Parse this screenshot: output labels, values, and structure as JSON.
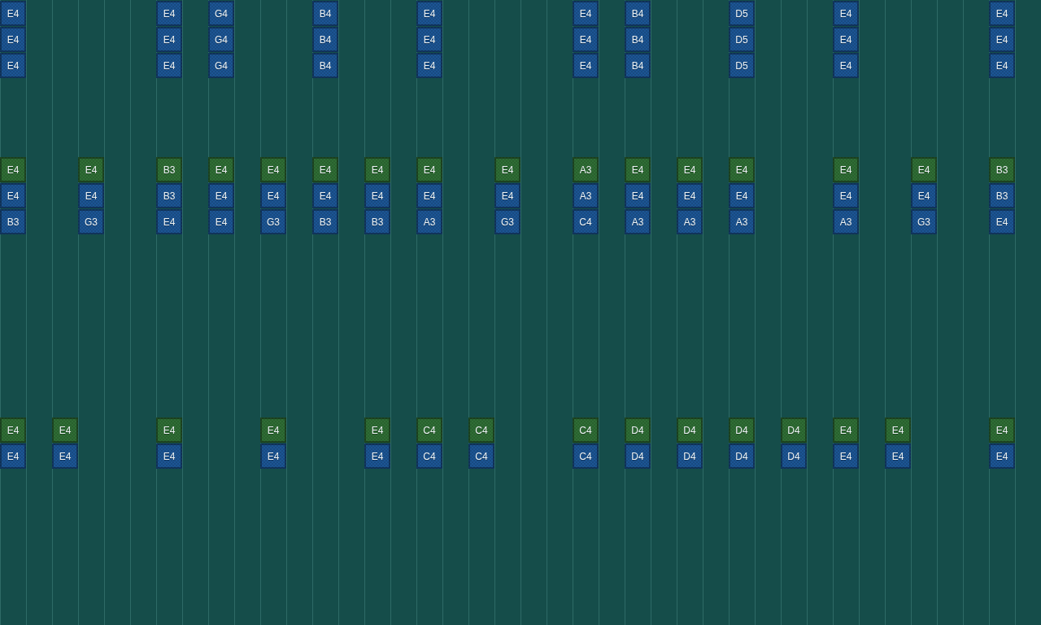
{
  "lanes": [
    {
      "cells": [
        {
          "note": "E4",
          "color": "#1c5594"
        },
        {
          "note": "E4",
          "color": "#1c5594"
        },
        {
          "note": "E4",
          "color": "#1c5594"
        },
        null,
        null,
        null,
        {
          "note": "E4",
          "color": "#2f6e35"
        },
        {
          "note": "E4",
          "color": "#1c5594"
        },
        {
          "note": "B3",
          "color": "#1c5594"
        },
        null,
        null,
        null,
        null,
        null,
        null,
        null,
        {
          "note": "E4",
          "color": "#2f6e35"
        },
        {
          "note": "E4",
          "color": "#1c5594"
        }
      ]
    },
    {
      "cells": [
        null,
        null,
        null,
        null,
        null,
        null,
        null,
        null,
        null,
        null,
        null,
        null,
        null,
        null,
        null,
        null,
        null,
        null
      ]
    },
    {
      "cells": [
        null,
        null,
        null,
        null,
        null,
        null,
        null,
        null,
        null,
        null,
        null,
        null,
        null,
        null,
        null,
        null,
        {
          "note": "E4",
          "color": "#2f6e35"
        },
        {
          "note": "E4",
          "color": "#1c5594"
        }
      ]
    },
    {
      "cells": [
        null,
        null,
        null,
        null,
        null,
        null,
        {
          "note": "E4",
          "color": "#2f6e35"
        },
        {
          "note": "E4",
          "color": "#1c5594"
        },
        {
          "note": "G3",
          "color": "#1c5594"
        },
        null,
        null,
        null,
        null,
        null,
        null,
        null,
        null,
        null
      ]
    },
    {
      "cells": [
        null,
        null,
        null,
        null,
        null,
        null,
        null,
        null,
        null,
        null,
        null,
        null,
        null,
        null,
        null,
        null,
        null,
        null
      ]
    },
    {
      "cells": [
        null,
        null,
        null,
        null,
        null,
        null,
        null,
        null,
        null,
        null,
        null,
        null,
        null,
        null,
        null,
        null,
        null,
        null
      ]
    },
    {
      "cells": [
        {
          "note": "E4",
          "color": "#1c5594"
        },
        {
          "note": "E4",
          "color": "#1c5594"
        },
        {
          "note": "E4",
          "color": "#1c5594"
        },
        null,
        null,
        null,
        {
          "note": "B3",
          "color": "#2f6e35"
        },
        {
          "note": "B3",
          "color": "#1c5594"
        },
        {
          "note": "E4",
          "color": "#1c5594"
        },
        null,
        null,
        null,
        null,
        null,
        null,
        null,
        {
          "note": "E4",
          "color": "#2f6e35"
        },
        {
          "note": "E4",
          "color": "#1c5594"
        }
      ]
    },
    {
      "cells": [
        null,
        null,
        null,
        null,
        null,
        null,
        null,
        null,
        null,
        null,
        null,
        null,
        null,
        null,
        null,
        null,
        null,
        null
      ]
    },
    {
      "cells": [
        {
          "note": "G4",
          "color": "#1c5594"
        },
        {
          "note": "G4",
          "color": "#1c5594"
        },
        {
          "note": "G4",
          "color": "#1c5594"
        },
        null,
        null,
        null,
        {
          "note": "E4",
          "color": "#2f6e35"
        },
        {
          "note": "E4",
          "color": "#1c5594"
        },
        {
          "note": "E4",
          "color": "#1c5594"
        },
        null,
        null,
        null,
        null,
        null,
        null,
        null,
        null,
        null
      ]
    },
    {
      "cells": [
        null,
        null,
        null,
        null,
        null,
        null,
        null,
        null,
        null,
        null,
        null,
        null,
        null,
        null,
        null,
        null,
        null,
        null
      ]
    },
    {
      "cells": [
        null,
        null,
        null,
        null,
        null,
        null,
        {
          "note": "E4",
          "color": "#2f6e35"
        },
        {
          "note": "E4",
          "color": "#1c5594"
        },
        {
          "note": "G3",
          "color": "#1c5594"
        },
        null,
        null,
        null,
        null,
        null,
        null,
        null,
        {
          "note": "E4",
          "color": "#2f6e35"
        },
        {
          "note": "E4",
          "color": "#1c5594"
        }
      ]
    },
    {
      "cells": [
        null,
        null,
        null,
        null,
        null,
        null,
        null,
        null,
        null,
        null,
        null,
        null,
        null,
        null,
        null,
        null,
        null,
        null
      ]
    },
    {
      "cells": [
        {
          "note": "B4",
          "color": "#1c5594"
        },
        {
          "note": "B4",
          "color": "#1c5594"
        },
        {
          "note": "B4",
          "color": "#1c5594"
        },
        null,
        null,
        null,
        {
          "note": "E4",
          "color": "#2f6e35"
        },
        {
          "note": "E4",
          "color": "#1c5594"
        },
        {
          "note": "B3",
          "color": "#1c5594"
        },
        null,
        null,
        null,
        null,
        null,
        null,
        null,
        null,
        null
      ]
    },
    {
      "cells": [
        null,
        null,
        null,
        null,
        null,
        null,
        null,
        null,
        null,
        null,
        null,
        null,
        null,
        null,
        null,
        null,
        null,
        null
      ]
    },
    {
      "cells": [
        null,
        null,
        null,
        null,
        null,
        null,
        {
          "note": "E4",
          "color": "#2f6e35"
        },
        {
          "note": "E4",
          "color": "#1c5594"
        },
        {
          "note": "B3",
          "color": "#1c5594"
        },
        null,
        null,
        null,
        null,
        null,
        null,
        null,
        {
          "note": "E4",
          "color": "#2f6e35"
        },
        {
          "note": "E4",
          "color": "#1c5594"
        }
      ]
    },
    {
      "cells": [
        null,
        null,
        null,
        null,
        null,
        null,
        null,
        null,
        null,
        null,
        null,
        null,
        null,
        null,
        null,
        null,
        null,
        null
      ]
    },
    {
      "cells": [
        {
          "note": "E4",
          "color": "#1c5594"
        },
        {
          "note": "E4",
          "color": "#1c5594"
        },
        {
          "note": "E4",
          "color": "#1c5594"
        },
        null,
        null,
        null,
        {
          "note": "E4",
          "color": "#2f6e35"
        },
        {
          "note": "E4",
          "color": "#1c5594"
        },
        {
          "note": "A3",
          "color": "#1c5594"
        },
        null,
        null,
        null,
        null,
        null,
        null,
        null,
        {
          "note": "C4",
          "color": "#2f6e35"
        },
        {
          "note": "C4",
          "color": "#1c5594"
        }
      ]
    },
    {
      "cells": [
        null,
        null,
        null,
        null,
        null,
        null,
        null,
        null,
        null,
        null,
        null,
        null,
        null,
        null,
        null,
        null,
        null,
        null
      ]
    },
    {
      "cells": [
        null,
        null,
        null,
        null,
        null,
        null,
        null,
        null,
        null,
        null,
        null,
        null,
        null,
        null,
        null,
        null,
        {
          "note": "C4",
          "color": "#2f6e35"
        },
        {
          "note": "C4",
          "color": "#1c5594"
        }
      ]
    },
    {
      "cells": [
        null,
        null,
        null,
        null,
        null,
        null,
        {
          "note": "E4",
          "color": "#2f6e35"
        },
        {
          "note": "E4",
          "color": "#1c5594"
        },
        {
          "note": "G3",
          "color": "#1c5594"
        },
        null,
        null,
        null,
        null,
        null,
        null,
        null,
        null,
        null
      ]
    },
    {
      "cells": [
        null,
        null,
        null,
        null,
        null,
        null,
        null,
        null,
        null,
        null,
        null,
        null,
        null,
        null,
        null,
        null,
        null,
        null
      ]
    },
    {
      "cells": [
        null,
        null,
        null,
        null,
        null,
        null,
        null,
        null,
        null,
        null,
        null,
        null,
        null,
        null,
        null,
        null,
        null,
        null
      ]
    },
    {
      "cells": [
        {
          "note": "E4",
          "color": "#1c5594"
        },
        {
          "note": "E4",
          "color": "#1c5594"
        },
        {
          "note": "E4",
          "color": "#1c5594"
        },
        null,
        null,
        null,
        {
          "note": "A3",
          "color": "#2f6e35"
        },
        {
          "note": "A3",
          "color": "#1c5594"
        },
        {
          "note": "C4",
          "color": "#1c5594"
        },
        null,
        null,
        null,
        null,
        null,
        null,
        null,
        {
          "note": "C4",
          "color": "#2f6e35"
        },
        {
          "note": "C4",
          "color": "#1c5594"
        }
      ]
    },
    {
      "cells": [
        null,
        null,
        null,
        null,
        null,
        null,
        null,
        null,
        null,
        null,
        null,
        null,
        null,
        null,
        null,
        null,
        null,
        null
      ]
    },
    {
      "cells": [
        {
          "note": "B4",
          "color": "#1c5594"
        },
        {
          "note": "B4",
          "color": "#1c5594"
        },
        {
          "note": "B4",
          "color": "#1c5594"
        },
        null,
        null,
        null,
        {
          "note": "E4",
          "color": "#2f6e35"
        },
        {
          "note": "E4",
          "color": "#1c5594"
        },
        {
          "note": "A3",
          "color": "#1c5594"
        },
        null,
        null,
        null,
        null,
        null,
        null,
        null,
        {
          "note": "D4",
          "color": "#2f6e35"
        },
        {
          "note": "D4",
          "color": "#1c5594"
        }
      ]
    },
    {
      "cells": [
        null,
        null,
        null,
        null,
        null,
        null,
        null,
        null,
        null,
        null,
        null,
        null,
        null,
        null,
        null,
        null,
        null,
        null
      ]
    },
    {
      "cells": [
        null,
        null,
        null,
        null,
        null,
        null,
        {
          "note": "E4",
          "color": "#2f6e35"
        },
        {
          "note": "E4",
          "color": "#1c5594"
        },
        {
          "note": "A3",
          "color": "#1c5594"
        },
        null,
        null,
        null,
        null,
        null,
        null,
        null,
        {
          "note": "D4",
          "color": "#2f6e35"
        },
        {
          "note": "D4",
          "color": "#1c5594"
        }
      ]
    },
    {
      "cells": [
        null,
        null,
        null,
        null,
        null,
        null,
        null,
        null,
        null,
        null,
        null,
        null,
        null,
        null,
        null,
        null,
        null,
        null
      ]
    },
    {
      "cells": [
        {
          "note": "D5",
          "color": "#1c5594"
        },
        {
          "note": "D5",
          "color": "#1c5594"
        },
        {
          "note": "D5",
          "color": "#1c5594"
        },
        null,
        null,
        null,
        {
          "note": "E4",
          "color": "#2f6e35"
        },
        {
          "note": "E4",
          "color": "#1c5594"
        },
        {
          "note": "A3",
          "color": "#1c5594"
        },
        null,
        null,
        null,
        null,
        null,
        null,
        null,
        {
          "note": "D4",
          "color": "#2f6e35"
        },
        {
          "note": "D4",
          "color": "#1c5594"
        }
      ]
    },
    {
      "cells": [
        null,
        null,
        null,
        null,
        null,
        null,
        null,
        null,
        null,
        null,
        null,
        null,
        null,
        null,
        null,
        null,
        null,
        null
      ]
    },
    {
      "cells": [
        null,
        null,
        null,
        null,
        null,
        null,
        null,
        null,
        null,
        null,
        null,
        null,
        null,
        null,
        null,
        null,
        {
          "note": "D4",
          "color": "#2f6e35"
        },
        {
          "note": "D4",
          "color": "#1c5594"
        }
      ]
    },
    {
      "cells": [
        null,
        null,
        null,
        null,
        null,
        null,
        null,
        null,
        null,
        null,
        null,
        null,
        null,
        null,
        null,
        null,
        null,
        null
      ]
    },
    {
      "cells": [
        {
          "note": "E4",
          "color": "#1c5594"
        },
        {
          "note": "E4",
          "color": "#1c5594"
        },
        {
          "note": "E4",
          "color": "#1c5594"
        },
        null,
        null,
        null,
        {
          "note": "E4",
          "color": "#2f6e35"
        },
        {
          "note": "E4",
          "color": "#1c5594"
        },
        {
          "note": "A3",
          "color": "#1c5594"
        },
        null,
        null,
        null,
        null,
        null,
        null,
        null,
        {
          "note": "E4",
          "color": "#2f6e35"
        },
        {
          "note": "E4",
          "color": "#1c5594"
        }
      ]
    },
    {
      "cells": [
        null,
        null,
        null,
        null,
        null,
        null,
        null,
        null,
        null,
        null,
        null,
        null,
        null,
        null,
        null,
        null,
        null,
        null
      ]
    },
    {
      "cells": [
        null,
        null,
        null,
        null,
        null,
        null,
        null,
        null,
        null,
        null,
        null,
        null,
        null,
        null,
        null,
        null,
        {
          "note": "E4",
          "color": "#2f6e35"
        },
        {
          "note": "E4",
          "color": "#1c5594"
        }
      ]
    },
    {
      "cells": [
        null,
        null,
        null,
        null,
        null,
        null,
        {
          "note": "E4",
          "color": "#2f6e35"
        },
        {
          "note": "E4",
          "color": "#1c5594"
        },
        {
          "note": "G3",
          "color": "#1c5594"
        },
        null,
        null,
        null,
        null,
        null,
        null,
        null,
        null,
        null
      ]
    },
    {
      "cells": [
        null,
        null,
        null,
        null,
        null,
        null,
        null,
        null,
        null,
        null,
        null,
        null,
        null,
        null,
        null,
        null,
        null,
        null
      ]
    },
    {
      "cells": [
        null,
        null,
        null,
        null,
        null,
        null,
        null,
        null,
        null,
        null,
        null,
        null,
        null,
        null,
        null,
        null,
        null,
        null
      ]
    },
    {
      "cells": [
        {
          "note": "E4",
          "color": "#1c5594"
        },
        {
          "note": "E4",
          "color": "#1c5594"
        },
        {
          "note": "E4",
          "color": "#1c5594"
        },
        null,
        null,
        null,
        {
          "note": "B3",
          "color": "#2f6e35"
        },
        {
          "note": "B3",
          "color": "#1c5594"
        },
        {
          "note": "E4",
          "color": "#1c5594"
        },
        null,
        null,
        null,
        null,
        null,
        null,
        null,
        {
          "note": "E4",
          "color": "#2f6e35"
        },
        {
          "note": "E4",
          "color": "#1c5594"
        }
      ]
    },
    {
      "cells": [
        null,
        null,
        null,
        null,
        null,
        null,
        null,
        null,
        null,
        null,
        null,
        null,
        null,
        null,
        null,
        null,
        null,
        null
      ]
    }
  ]
}
